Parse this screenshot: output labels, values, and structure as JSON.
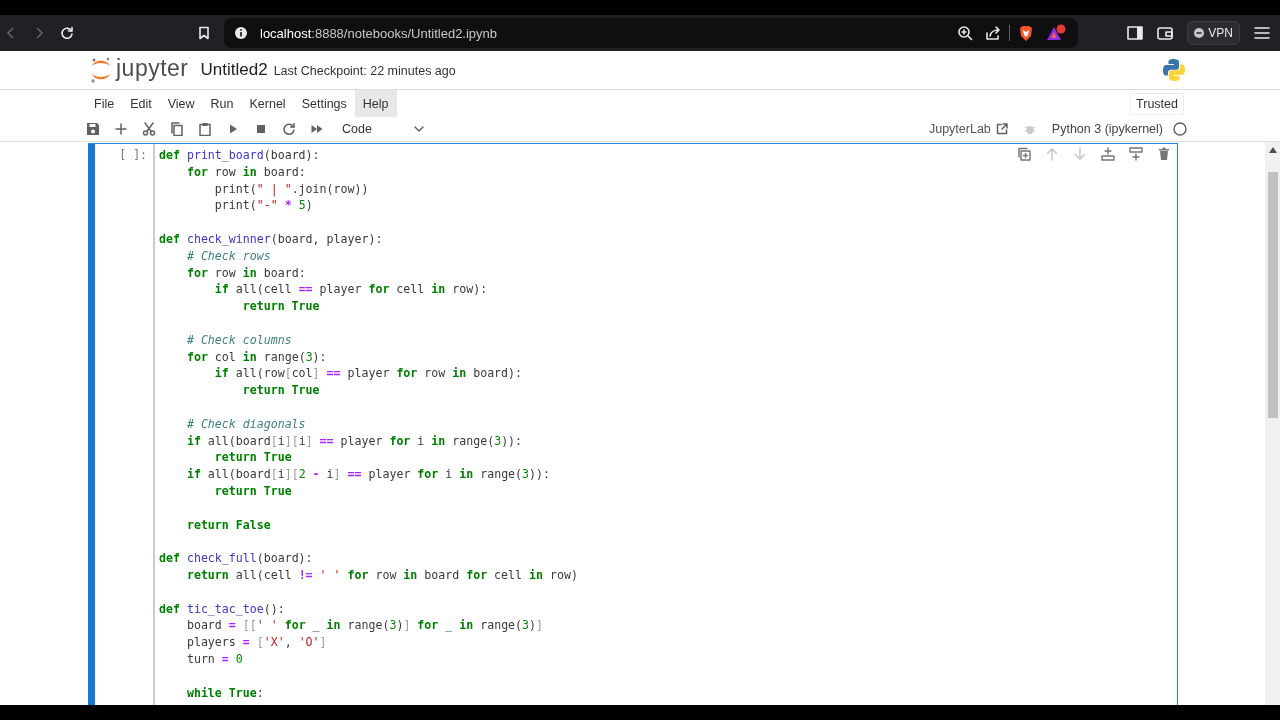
{
  "browser": {
    "url_host": "localhost",
    "url_rest": ":8888/notebooks/Untitled2.ipynb",
    "vpn_label": "VPN"
  },
  "header": {
    "logo_text": "jupyter",
    "notebook_title": "Untitled2",
    "checkpoint": "Last Checkpoint: 22 minutes ago"
  },
  "menu": [
    {
      "label": "File",
      "selected": false
    },
    {
      "label": "Edit",
      "selected": false
    },
    {
      "label": "View",
      "selected": false
    },
    {
      "label": "Run",
      "selected": false
    },
    {
      "label": "Kernel",
      "selected": false
    },
    {
      "label": "Settings",
      "selected": false
    },
    {
      "label": "Help",
      "selected": true
    }
  ],
  "trusted": "Trusted",
  "toolbar": {
    "cell_type": "Code",
    "jupyterlab_link": "JupyterLab",
    "kernel_name": "Python 3 (ipykernel)",
    "kernel_busy": false
  },
  "cell": {
    "selected": true,
    "prompt": "[ ]:",
    "lines": [
      {
        "kind": "code",
        "tokens": [
          {
            "kind": "k",
            "text": "def"
          },
          {
            "kind": "d",
            "text": " print_board"
          },
          {
            "kind": "p",
            "text": "(board):"
          }
        ]
      },
      {
        "kind": "code",
        "tokens": [
          {
            "kind": "k",
            "text": "    for"
          },
          {
            "kind": "p",
            "text": " row "
          },
          {
            "kind": "k",
            "text": "in"
          },
          {
            "kind": "p",
            "text": " board:"
          }
        ]
      },
      {
        "kind": "code",
        "tokens": [
          {
            "kind": "p",
            "text": "        print("
          },
          {
            "kind": "s",
            "text": "\" | \""
          },
          {
            "kind": "p",
            "text": ".join(row))"
          }
        ]
      },
      {
        "kind": "code",
        "tokens": [
          {
            "kind": "p",
            "text": "        print("
          },
          {
            "kind": "s",
            "text": "\"-\""
          },
          {
            "kind": "o",
            "text": " *"
          },
          {
            "kind": "n",
            "text": " 5"
          },
          {
            "kind": "p",
            "text": ")"
          }
        ]
      },
      {
        "kind": "blank"
      },
      {
        "kind": "code",
        "tokens": [
          {
            "kind": "k",
            "text": "def"
          },
          {
            "kind": "d",
            "text": " check_winner"
          },
          {
            "kind": "p",
            "text": "(board, player):"
          }
        ]
      },
      {
        "kind": "code",
        "tokens": [
          {
            "kind": "c",
            "text": "    # Check rows"
          }
        ]
      },
      {
        "kind": "code",
        "tokens": [
          {
            "kind": "k",
            "text": "    for"
          },
          {
            "kind": "p",
            "text": " row "
          },
          {
            "kind": "k",
            "text": "in"
          },
          {
            "kind": "p",
            "text": " board:"
          }
        ]
      },
      {
        "kind": "code",
        "tokens": [
          {
            "kind": "k",
            "text": "        if"
          },
          {
            "kind": "p",
            "text": " all(cell "
          },
          {
            "kind": "o",
            "text": "=="
          },
          {
            "kind": "p",
            "text": " player "
          },
          {
            "kind": "k",
            "text": "for"
          },
          {
            "kind": "p",
            "text": " cell "
          },
          {
            "kind": "k",
            "text": "in"
          },
          {
            "kind": "p",
            "text": " row):"
          }
        ]
      },
      {
        "kind": "code",
        "tokens": [
          {
            "kind": "k",
            "text": "            return True"
          }
        ]
      },
      {
        "kind": "blank"
      },
      {
        "kind": "code",
        "tokens": [
          {
            "kind": "c",
            "text": "    # Check columns"
          }
        ]
      },
      {
        "kind": "code",
        "tokens": [
          {
            "kind": "k",
            "text": "    for"
          },
          {
            "kind": "p",
            "text": " col "
          },
          {
            "kind": "k",
            "text": "in"
          },
          {
            "kind": "p",
            "text": " range("
          },
          {
            "kind": "n",
            "text": "3"
          },
          {
            "kind": "p",
            "text": "):"
          }
        ]
      },
      {
        "kind": "code",
        "tokens": [
          {
            "kind": "k",
            "text": "        if"
          },
          {
            "kind": "p",
            "text": " all(row"
          },
          {
            "kind": "b",
            "text": "["
          },
          {
            "kind": "p",
            "text": "col"
          },
          {
            "kind": "b",
            "text": "]"
          },
          {
            "kind": "o",
            "text": " =="
          },
          {
            "kind": "p",
            "text": " player "
          },
          {
            "kind": "k",
            "text": "for"
          },
          {
            "kind": "p",
            "text": " row "
          },
          {
            "kind": "k",
            "text": "in"
          },
          {
            "kind": "p",
            "text": " board):"
          }
        ]
      },
      {
        "kind": "code",
        "tokens": [
          {
            "kind": "k",
            "text": "            return True"
          }
        ]
      },
      {
        "kind": "blank"
      },
      {
        "kind": "code",
        "tokens": [
          {
            "kind": "c",
            "text": "    # Check diagonals"
          }
        ]
      },
      {
        "kind": "code",
        "tokens": [
          {
            "kind": "k",
            "text": "    if"
          },
          {
            "kind": "p",
            "text": " all(board"
          },
          {
            "kind": "b",
            "text": "["
          },
          {
            "kind": "p",
            "text": "i"
          },
          {
            "kind": "b",
            "text": "]["
          },
          {
            "kind": "p",
            "text": "i"
          },
          {
            "kind": "b",
            "text": "]"
          },
          {
            "kind": "o",
            "text": " =="
          },
          {
            "kind": "p",
            "text": " player "
          },
          {
            "kind": "k",
            "text": "for"
          },
          {
            "kind": "p",
            "text": " i "
          },
          {
            "kind": "k",
            "text": "in"
          },
          {
            "kind": "p",
            "text": " range("
          },
          {
            "kind": "n",
            "text": "3"
          },
          {
            "kind": "p",
            "text": ")):"
          }
        ]
      },
      {
        "kind": "code",
        "tokens": [
          {
            "kind": "k",
            "text": "        return True"
          }
        ]
      },
      {
        "kind": "code",
        "tokens": [
          {
            "kind": "k",
            "text": "    if"
          },
          {
            "kind": "p",
            "text": " all(board"
          },
          {
            "kind": "b",
            "text": "["
          },
          {
            "kind": "p",
            "text": "i"
          },
          {
            "kind": "b",
            "text": "]["
          },
          {
            "kind": "n",
            "text": "2"
          },
          {
            "kind": "o",
            "text": " -"
          },
          {
            "kind": "p",
            "text": " i"
          },
          {
            "kind": "b",
            "text": "]"
          },
          {
            "kind": "o",
            "text": " =="
          },
          {
            "kind": "p",
            "text": " player "
          },
          {
            "kind": "k",
            "text": "for"
          },
          {
            "kind": "p",
            "text": " i "
          },
          {
            "kind": "k",
            "text": "in"
          },
          {
            "kind": "p",
            "text": " range("
          },
          {
            "kind": "n",
            "text": "3"
          },
          {
            "kind": "p",
            "text": ")):"
          }
        ]
      },
      {
        "kind": "code",
        "tokens": [
          {
            "kind": "k",
            "text": "        return True"
          }
        ]
      },
      {
        "kind": "blank"
      },
      {
        "kind": "code",
        "tokens": [
          {
            "kind": "k",
            "text": "    return False"
          }
        ]
      },
      {
        "kind": "blank"
      },
      {
        "kind": "code",
        "tokens": [
          {
            "kind": "k",
            "text": "def"
          },
          {
            "kind": "d",
            "text": " check_full"
          },
          {
            "kind": "p",
            "text": "(board):"
          }
        ]
      },
      {
        "kind": "code",
        "tokens": [
          {
            "kind": "k",
            "text": "    return"
          },
          {
            "kind": "p",
            "text": " all(cell "
          },
          {
            "kind": "o",
            "text": "!="
          },
          {
            "kind": "s",
            "text": " ' '"
          },
          {
            "kind": "k",
            "text": " for"
          },
          {
            "kind": "p",
            "text": " row "
          },
          {
            "kind": "k",
            "text": "in"
          },
          {
            "kind": "p",
            "text": " board "
          },
          {
            "kind": "k",
            "text": "for"
          },
          {
            "kind": "p",
            "text": " cell "
          },
          {
            "kind": "k",
            "text": "in"
          },
          {
            "kind": "p",
            "text": " row)"
          }
        ]
      },
      {
        "kind": "blank"
      },
      {
        "kind": "code",
        "tokens": [
          {
            "kind": "k",
            "text": "def"
          },
          {
            "kind": "d",
            "text": " tic_tac_toe"
          },
          {
            "kind": "p",
            "text": "():"
          }
        ]
      },
      {
        "kind": "code",
        "tokens": [
          {
            "kind": "p",
            "text": "    board "
          },
          {
            "kind": "o",
            "text": "="
          },
          {
            "kind": "b",
            "text": " [["
          },
          {
            "kind": "s",
            "text": "' '"
          },
          {
            "kind": "k",
            "text": " for"
          },
          {
            "kind": "p",
            "text": " _ "
          },
          {
            "kind": "k",
            "text": "in"
          },
          {
            "kind": "p",
            "text": " range("
          },
          {
            "kind": "n",
            "text": "3"
          },
          {
            "kind": "p",
            "text": ")"
          },
          {
            "kind": "b",
            "text": "]"
          },
          {
            "kind": "k",
            "text": " for"
          },
          {
            "kind": "p",
            "text": " _ "
          },
          {
            "kind": "k",
            "text": "in"
          },
          {
            "kind": "p",
            "text": " range("
          },
          {
            "kind": "n",
            "text": "3"
          },
          {
            "kind": "p",
            "text": ")"
          },
          {
            "kind": "b",
            "text": "]"
          }
        ]
      },
      {
        "kind": "code",
        "tokens": [
          {
            "kind": "p",
            "text": "    players "
          },
          {
            "kind": "o",
            "text": "="
          },
          {
            "kind": "b",
            "text": " ["
          },
          {
            "kind": "s",
            "text": "'X'"
          },
          {
            "kind": "p",
            "text": ", "
          },
          {
            "kind": "s",
            "text": "'O'"
          },
          {
            "kind": "b",
            "text": "]"
          }
        ]
      },
      {
        "kind": "code",
        "tokens": [
          {
            "kind": "p",
            "text": "    turn "
          },
          {
            "kind": "o",
            "text": "="
          },
          {
            "kind": "n",
            "text": " 0"
          }
        ]
      },
      {
        "kind": "blank"
      },
      {
        "kind": "code",
        "tokens": [
          {
            "kind": "k",
            "text": "    while True"
          },
          {
            "kind": "p",
            "text": ":"
          }
        ]
      }
    ]
  }
}
